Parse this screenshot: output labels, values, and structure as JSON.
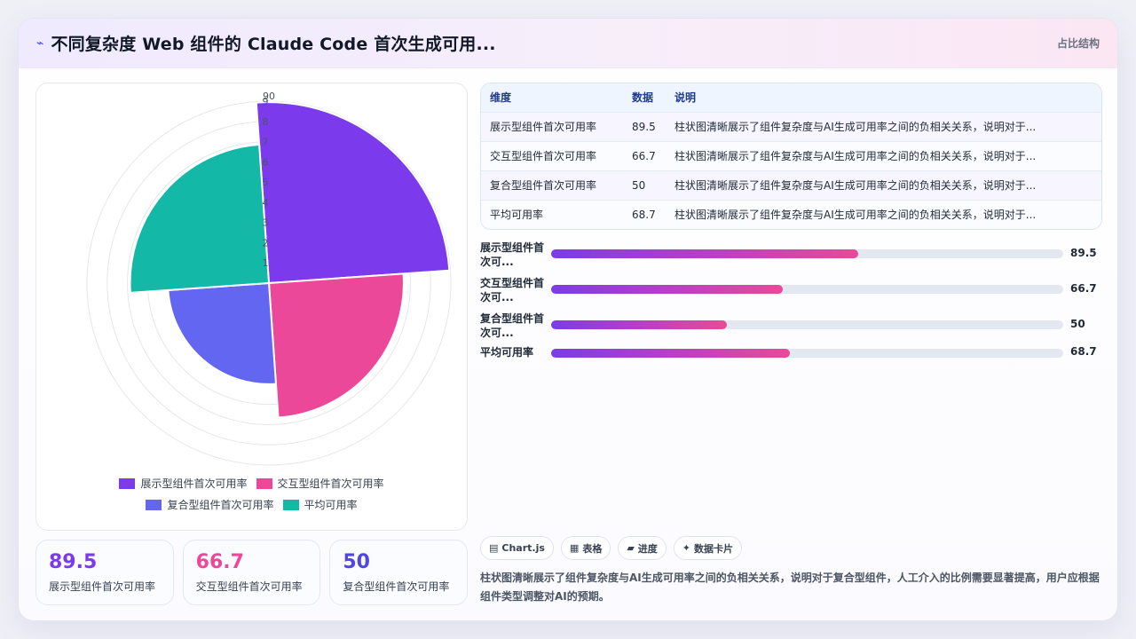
{
  "header": {
    "icon": "sparkline-icon",
    "icon_glyph": "⌁",
    "title": "不同复杂度 Web 组件的 Claude Code 首次生成可用...",
    "badge": "占比结构"
  },
  "chart_data": {
    "type": "polarArea",
    "categories": [
      "展示型组件首次可用率",
      "交互型组件首次可用率",
      "复合型组件首次可用率",
      "平均可用率"
    ],
    "values": [
      89.5,
      66.7,
      50,
      68.7
    ],
    "colors": [
      "#7c3aed",
      "#ec4899",
      "#6366f1",
      "#14b8a6"
    ],
    "r_ticks": [
      "1",
      "2",
      "3",
      "4",
      "5",
      "6",
      "7",
      "8",
      "9"
    ],
    "r_max_label": "90",
    "grid": true,
    "legend_position": "bottom"
  },
  "stats": [
    {
      "value": "89.5",
      "label": "展示型组件首次可用率",
      "color": "#7c3aed"
    },
    {
      "value": "66.7",
      "label": "交互型组件首次可用率",
      "color": "#ec4899"
    },
    {
      "value": "50",
      "label": "复合型组件首次可用率",
      "color": "#4f46e5"
    }
  ],
  "table": {
    "headers": [
      "维度",
      "数据",
      "说明"
    ],
    "rows": [
      [
        "展示型组件首次可用率",
        "89.5",
        "柱状图清晰展示了组件复杂度与AI生成可用率之间的负相关关系，说明对于..."
      ],
      [
        "交互型组件首次可用率",
        "66.7",
        "柱状图清晰展示了组件复杂度与AI生成可用率之间的负相关关系，说明对于..."
      ],
      [
        "复合型组件首次可用率",
        "50",
        "柱状图清晰展示了组件复杂度与AI生成可用率之间的负相关关系，说明对于..."
      ],
      [
        "平均可用率",
        "68.7",
        "柱状图清晰展示了组件复杂度与AI生成可用率之间的负相关关系，说明对于..."
      ]
    ]
  },
  "progress": [
    {
      "label_line1": "展示型组件首",
      "label_line2": "次可...",
      "value": "89.5",
      "fraction": 0.6
    },
    {
      "label_line1": "交互型组件首",
      "label_line2": "次可...",
      "value": "66.7",
      "fraction": 0.452
    },
    {
      "label_line1": "复合型组件首",
      "label_line2": "次可...",
      "value": "50",
      "fraction": 0.343
    },
    {
      "label_line1": "平均可用率",
      "label_line2": "",
      "value": "68.7",
      "fraction": 0.466
    }
  ],
  "chips": [
    {
      "icon": "chart-icon",
      "glyph": "▤",
      "label": "Chart.js"
    },
    {
      "icon": "table-icon",
      "glyph": "▦",
      "label": "表格"
    },
    {
      "icon": "progress-icon",
      "glyph": "▰",
      "label": "进度"
    },
    {
      "icon": "sparkle-icon",
      "glyph": "✦",
      "label": "数据卡片"
    }
  ],
  "description": "柱状图清晰展示了组件复杂度与AI生成可用率之间的负相关关系，说明对于复合型组件，人工介入的比例需要显著提高，用户应根据组件类型调整对AI的预期。"
}
